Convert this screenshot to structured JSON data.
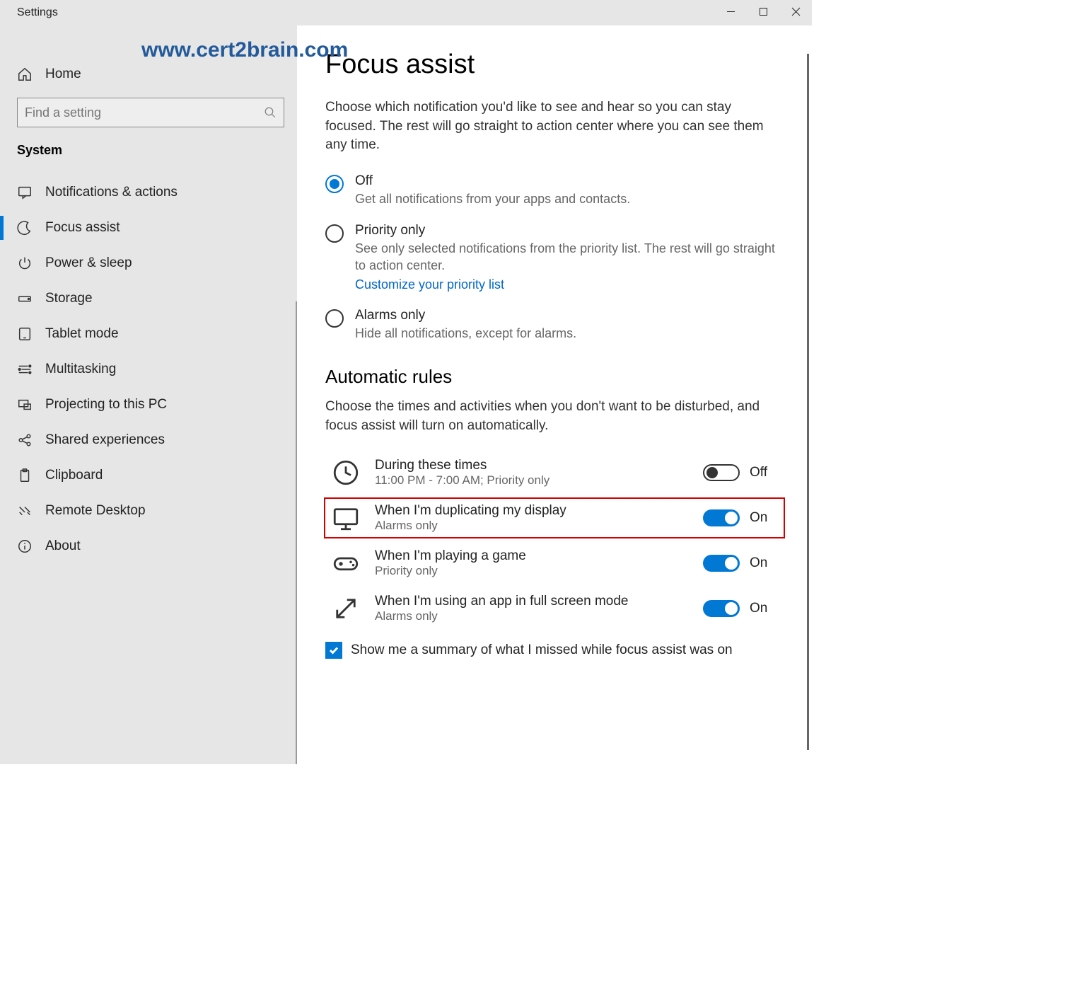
{
  "titlebar": {
    "title": "Settings"
  },
  "watermark": "www.cert2brain.com",
  "sidebar": {
    "home_label": "Home",
    "search_placeholder": "Find a setting",
    "section_title": "System",
    "items": [
      {
        "label": "Notifications & actions"
      },
      {
        "label": "Focus assist"
      },
      {
        "label": "Power & sleep"
      },
      {
        "label": "Storage"
      },
      {
        "label": "Tablet mode"
      },
      {
        "label": "Multitasking"
      },
      {
        "label": "Projecting to this PC"
      },
      {
        "label": "Shared experiences"
      },
      {
        "label": "Clipboard"
      },
      {
        "label": "Remote Desktop"
      },
      {
        "label": "About"
      }
    ]
  },
  "main": {
    "heading": "Focus assist",
    "description": "Choose which notification you'd like to see and hear so you can stay focused. The rest will go straight to action center where you can see them any time.",
    "radios": [
      {
        "label": "Off",
        "desc": "Get all notifications from your apps and contacts.",
        "checked": true
      },
      {
        "label": "Priority only",
        "desc": "See only selected notifications from the priority list. The rest will go straight to action center.",
        "link": "Customize your priority list",
        "checked": false
      },
      {
        "label": "Alarms only",
        "desc": "Hide all notifications, except for alarms.",
        "checked": false
      }
    ],
    "rules_heading": "Automatic rules",
    "rules_desc": "Choose the times and activities when you don't want to be disturbed, and focus assist will turn on automatically.",
    "rules": [
      {
        "title": "During these times",
        "subtitle": "11:00 PM - 7:00 AM; Priority only",
        "state_label": "Off",
        "on": false
      },
      {
        "title": "When I'm duplicating my display",
        "subtitle": "Alarms only",
        "state_label": "On",
        "on": true,
        "highlight": true
      },
      {
        "title": "When I'm playing a game",
        "subtitle": "Priority only",
        "state_label": "On",
        "on": true
      },
      {
        "title": "When I'm using an app in full screen mode",
        "subtitle": "Alarms only",
        "state_label": "On",
        "on": true
      }
    ],
    "summary_checkbox_label": "Show me a summary of what I missed while focus assist was on",
    "summary_checked": true
  }
}
